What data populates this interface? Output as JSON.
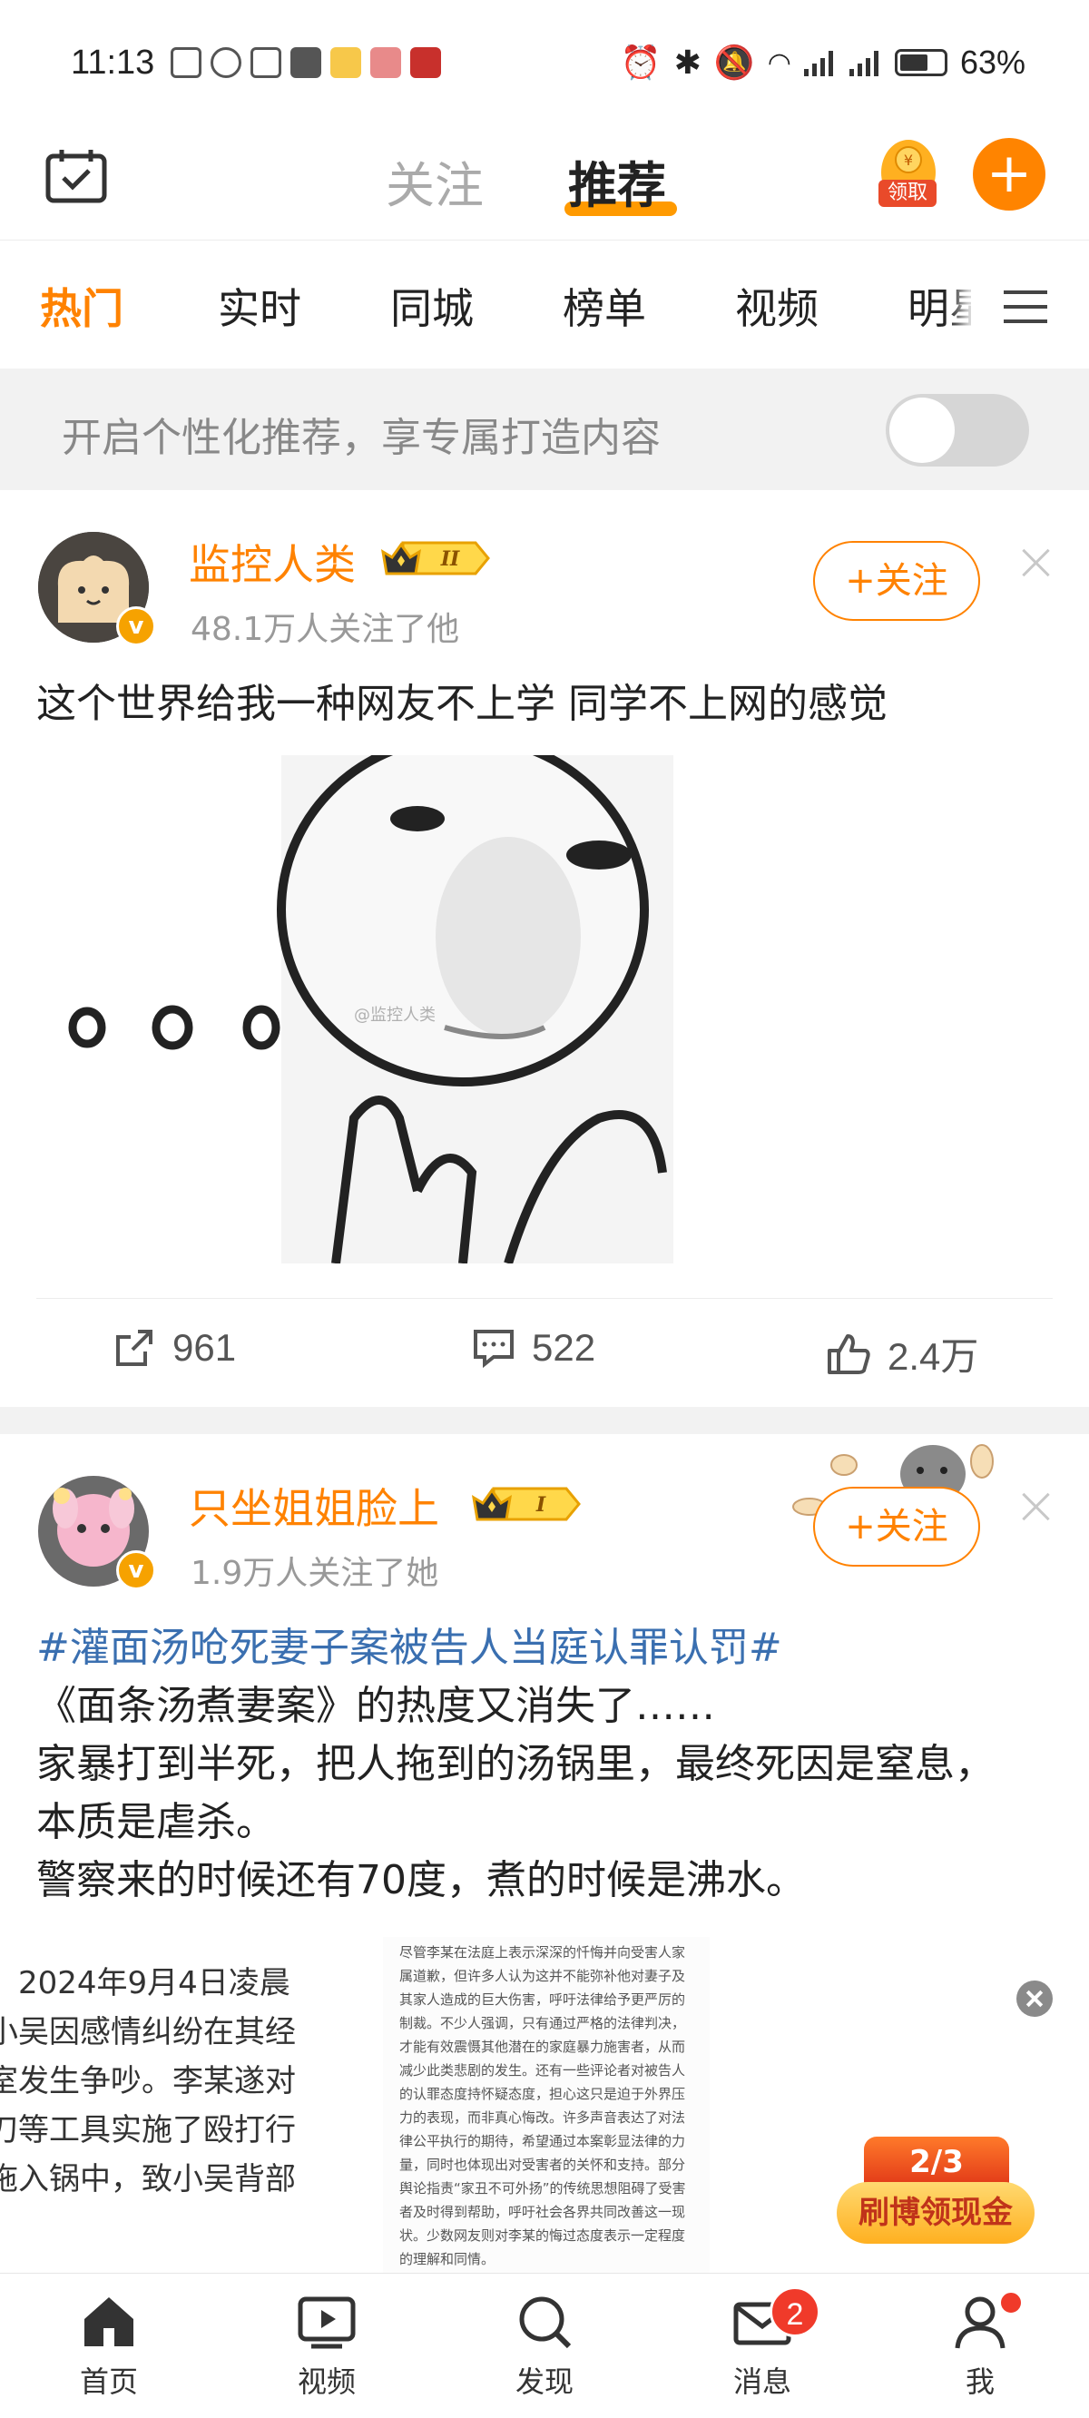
{
  "status_bar": {
    "time": "11:13",
    "battery": "63%"
  },
  "header": {
    "tab_follow": "关注",
    "tab_recommend": "推荐",
    "bonus_label": "领取"
  },
  "categories": [
    "热门",
    "实时",
    "同城",
    "榜单",
    "视频",
    "明星"
  ],
  "personalization": {
    "text": "开启个性化推荐，享专属打造内容"
  },
  "posts": [
    {
      "username": "监控人类",
      "level": "II",
      "followers": "48.1万人关注了他",
      "follow_label": "+关注",
      "text": "这个世界给我一种网友不上学 同学不上网的感觉",
      "watermark": "@监控人类",
      "reposts": "961",
      "comments": "522",
      "likes": "2.4万"
    },
    {
      "username": "只坐姐姐脸上",
      "level": "I",
      "followers": "1.9万人关注了她",
      "follow_label": "+关注",
      "hashtag": "#灌面汤呛死妻子案被告人当庭认罪认罚#",
      "lines": [
        "《面条汤煮妻案》的热度又消失了……",
        "家暴打到半死，把人拖到的汤锅里，最终死因是窒息，",
        "本质是虐杀。",
        "警察来的时候还有70度，煮的时候是沸水。"
      ],
      "thumb_left_lines": [
        "，2024年9月4日凌晨",
        "小吴因感情纠纷在其经",
        "室发生争吵。李某遂对",
        "刀等工具实施了殴打行",
        "拖入锅中，致小吴背部"
      ],
      "thumb_mid_text": "尽管李某在法庭上表示深深的忏悔并向受害人家属道歉，但许多人认为这并不能弥补他对妻子及其家人造成的巨大伤害，呼吁法律给予更严厉的制裁。不少人强调，只有通过严格的法律判决，才能有效震慑其他潜在的家庭暴力施害者，从而减少此类悲剧的发生。还有一些评论者对被告人的认罪态度持怀疑态度，担心这只是迫于外界压力的表现，而非真心悔改。许多声音表达了对法律公平执行的期待，希望通过本案彰显法律的力量，同时也体现出对受害者的关怀和支持。部分舆论指责“家丑不可外扬”的传统思想阻碍了受害者及时得到帮助，呼吁社会各界共同改善这一现状。少数网友则对李某的悔过态度表示一定程度的理解和同情。"
    }
  ],
  "promo": {
    "progress": "2/3",
    "label": "刷博领现金"
  },
  "bottom_nav": [
    {
      "label": "首页"
    },
    {
      "label": "视频"
    },
    {
      "label": "发现"
    },
    {
      "label": "消息",
      "badge": "2"
    },
    {
      "label": "我"
    }
  ],
  "colors": {
    "brand_orange": "#ff8200",
    "hashtag_blue": "#3a6fb0",
    "badge_red": "#f03a2a"
  }
}
